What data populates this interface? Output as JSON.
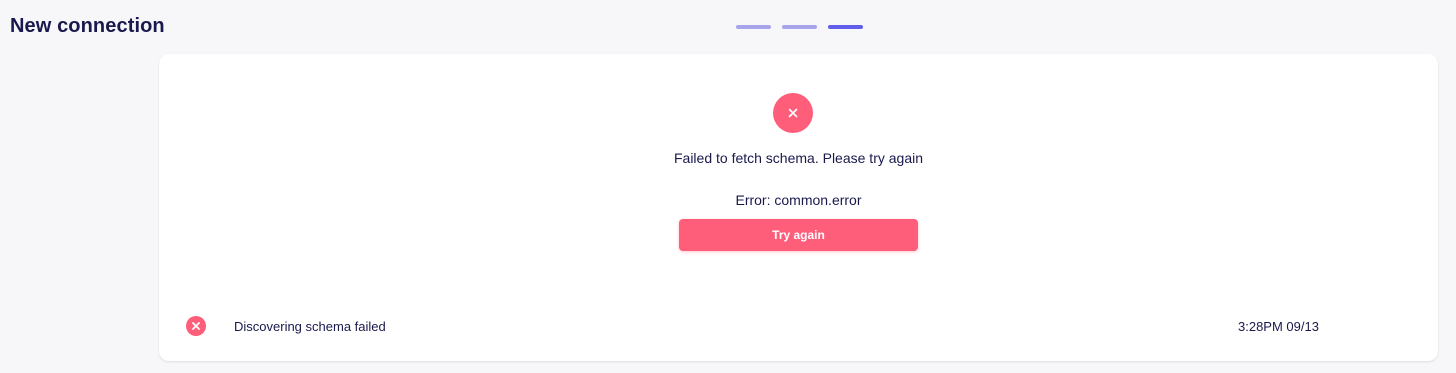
{
  "header": {
    "title": "New connection",
    "steps": [
      {
        "state": "completed"
      },
      {
        "state": "completed"
      },
      {
        "state": "current"
      }
    ]
  },
  "status": {
    "icon": "close-icon",
    "message": "Failed to fetch schema. Please try again",
    "error": "Error: common.error",
    "retry_label": "Try again"
  },
  "log": {
    "icon": "error-x-icon",
    "text": "Discovering schema failed",
    "time": "3:28PM 09/13"
  },
  "colors": {
    "error": "#ff5e7b",
    "accent": "#615eeb",
    "accent_light": "#a8a4ea",
    "text": "#1a194d",
    "background": "#f7f7fa"
  }
}
